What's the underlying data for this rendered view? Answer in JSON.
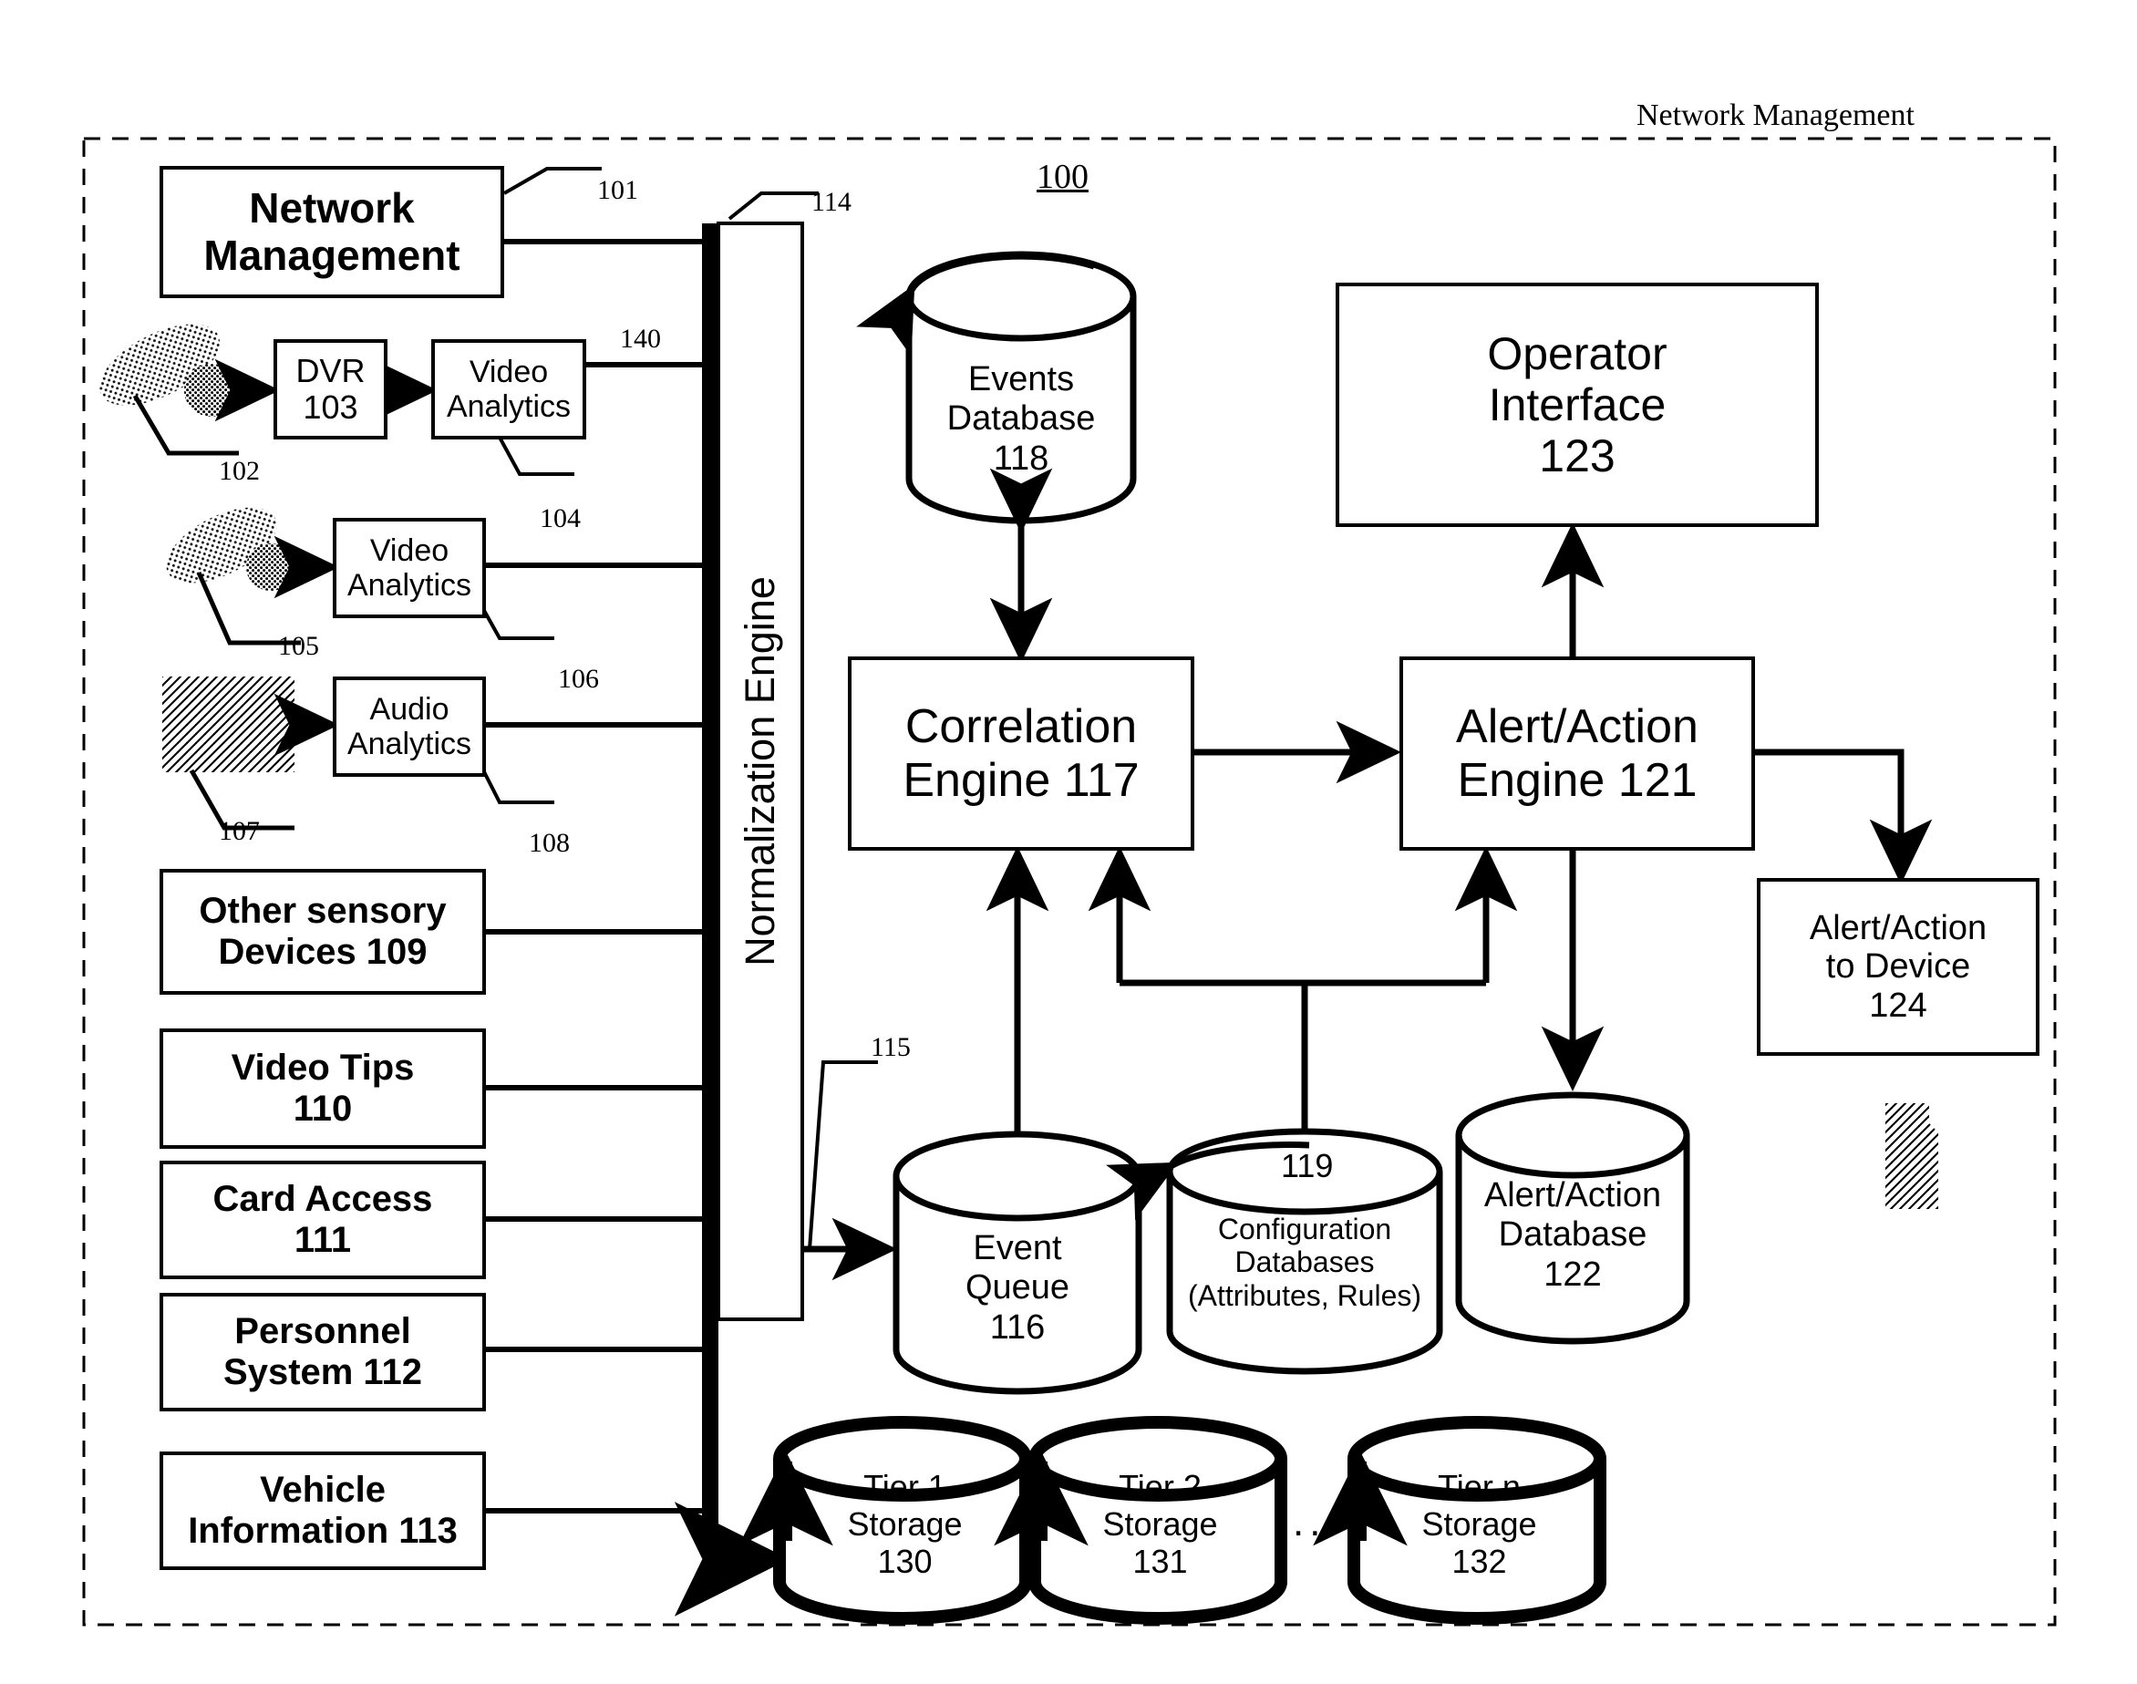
{
  "figure": {
    "caption": "Network Management",
    "figure_number": "100",
    "border_style": "dashed"
  },
  "blocks": {
    "network_management": {
      "line1": "Network",
      "line2": "Management",
      "ref": "101"
    },
    "dvr": {
      "line1": "DVR",
      "line2": "103"
    },
    "video_analytics_1": {
      "line1": "Video",
      "line2": "Analytics",
      "ref": "140"
    },
    "video_analytics_2": {
      "line1": "Video",
      "line2": "Analytics",
      "ref": "106"
    },
    "audio_analytics": {
      "line1": "Audio",
      "line2": "Analytics",
      "ref": "108"
    },
    "other_sensory": {
      "line1": "Other sensory",
      "line2": "Devices 109"
    },
    "video_tips": {
      "line1": "Video Tips",
      "line2": "110"
    },
    "card_access": {
      "line1": "Card Access",
      "line2": "111"
    },
    "personnel_system": {
      "line1": "Personnel",
      "line2": "System 112"
    },
    "vehicle_information": {
      "line1": "Vehicle",
      "line2": "Information 113"
    },
    "normalization_engine": {
      "label": "Normalization Engine",
      "ref": "114"
    },
    "correlation_engine": {
      "line1": "Correlation",
      "line2": "Engine 117"
    },
    "alert_action_engine": {
      "line1": "Alert/Action",
      "line2": "Engine 121"
    },
    "operator_interface": {
      "line1": "Operator",
      "line2": "Interface",
      "line3": "123"
    },
    "alert_action_to_device": {
      "line1": "Alert/Action",
      "line2": "to Device",
      "line3": "124"
    }
  },
  "databases": {
    "events_database": {
      "line1": "Events",
      "line2": "Database",
      "line3": "118"
    },
    "event_queue": {
      "line1": "Event",
      "line2": "Queue",
      "line3": "116",
      "ref": "115"
    },
    "configuration_databases": {
      "line1": "Configuration",
      "line2": "Databases",
      "line3": "(Attributes, Rules)",
      "ref": "119"
    },
    "alert_action_database": {
      "line1": "Alert/Action",
      "line2": "Database",
      "line3": "122"
    },
    "tier1_storage": {
      "line1": "Tier 1",
      "line2": "Storage",
      "line3": "130"
    },
    "tier2_storage": {
      "line1": "Tier 2",
      "line2": "Storage",
      "line3": "131"
    },
    "tiern_storage": {
      "line1": "Tier n",
      "line2": "Storage",
      "line3": "132"
    },
    "ellipsis": "..."
  },
  "sensors": {
    "camera_1_ref": "102",
    "camera_2_ref": "105",
    "microphone_ref": "107"
  },
  "reference_numerals": {
    "n101": "101",
    "n102": "102",
    "n104": "104",
    "n105": "105",
    "n106": "106",
    "n107": "107",
    "n108": "108",
    "n114": "114",
    "n115": "115",
    "n119": "119",
    "n140": "140"
  },
  "colors": {
    "stroke": "#000000",
    "background": "#ffffff"
  }
}
